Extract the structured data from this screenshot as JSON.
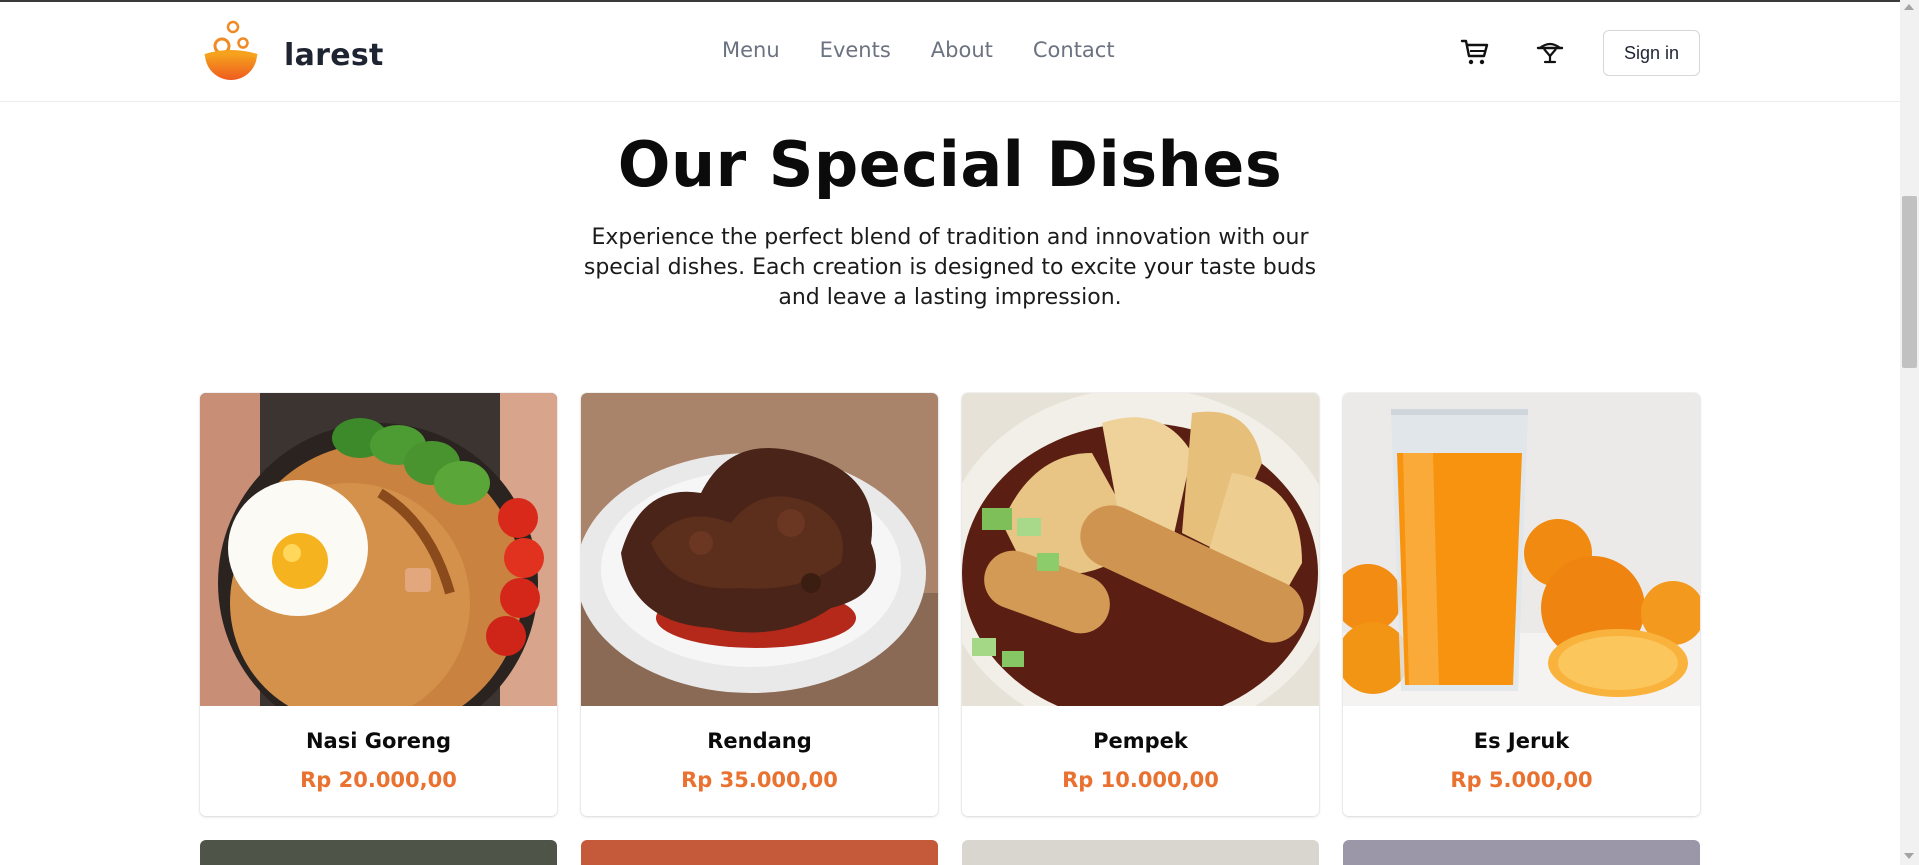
{
  "brand": {
    "name": "larest",
    "logo_icon": "bowl-logo-icon"
  },
  "nav": {
    "items": [
      "Menu",
      "Events",
      "About",
      "Contact"
    ]
  },
  "header_actions": {
    "cart_icon": "cart-icon",
    "dish_icon": "cloche-icon",
    "sign_in_label": "Sign in"
  },
  "section": {
    "title": "Our Special Dishes",
    "description": "Experience the perfect blend of tradition and innovation with our special dishes. Each creation is designed to excite your taste buds and leave a lasting impression."
  },
  "dishes": [
    {
      "name": "Nasi Goreng",
      "price": "Rp 20.000,00"
    },
    {
      "name": "Rendang",
      "price": "Rp 35.000,00"
    },
    {
      "name": "Pempek",
      "price": "Rp 10.000,00"
    },
    {
      "name": "Es Jeruk",
      "price": "Rp 5.000,00"
    }
  ],
  "colors": {
    "accent": "#ea7230",
    "logo_orange": "#f08a24",
    "text_dark": "#1f2432",
    "nav_gray": "#6b7280"
  }
}
